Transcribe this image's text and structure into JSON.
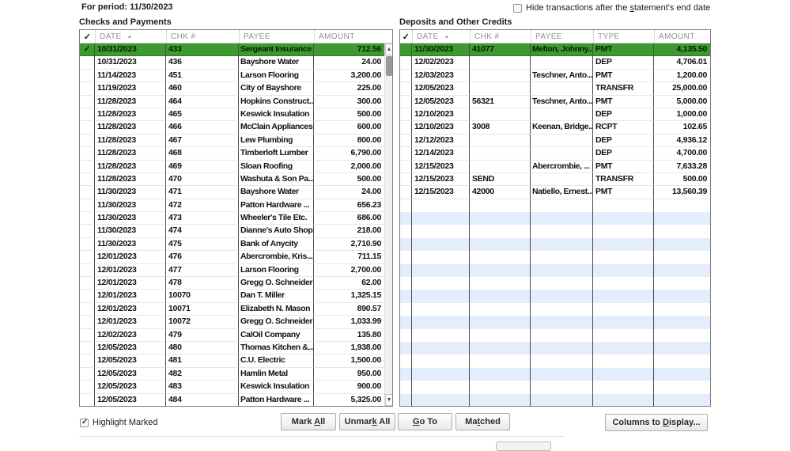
{
  "period_label": "For period: 11/30/2023",
  "hide_checkbox": {
    "checked": false,
    "label_pre": "Hide transactions after the ",
    "label_u": "s",
    "label_post": "tatement's end date"
  },
  "glyphs": {
    "check": "✓",
    "sort_arrow": "▲",
    "scroll_up": "▲",
    "scroll_down": "▼"
  },
  "checks": {
    "title": "Checks and Payments",
    "headers": [
      "DATE",
      "CHK #",
      "PAYEE",
      "AMOUNT"
    ],
    "rows": [
      {
        "checked": true,
        "highlight": true,
        "date": "10/31/2023",
        "chk": "433",
        "payee": "Sergeant Insurance",
        "amount": "712.56"
      },
      {
        "checked": false,
        "highlight": false,
        "date": "10/31/2023",
        "chk": "436",
        "payee": "Bayshore Water",
        "amount": "24.00"
      },
      {
        "checked": false,
        "highlight": false,
        "date": "11/14/2023",
        "chk": "451",
        "payee": "Larson Flooring",
        "amount": "3,200.00"
      },
      {
        "checked": false,
        "highlight": false,
        "date": "11/19/2023",
        "chk": "460",
        "payee": "City of Bayshore",
        "amount": "225.00"
      },
      {
        "checked": false,
        "highlight": false,
        "date": "11/28/2023",
        "chk": "464",
        "payee": "Hopkins Construct...",
        "amount": "300.00"
      },
      {
        "checked": false,
        "highlight": false,
        "date": "11/28/2023",
        "chk": "465",
        "payee": "Keswick Insulation",
        "amount": "500.00"
      },
      {
        "checked": false,
        "highlight": false,
        "date": "11/28/2023",
        "chk": "466",
        "payee": "McClain Appliances",
        "amount": "600.00"
      },
      {
        "checked": false,
        "highlight": false,
        "date": "11/28/2023",
        "chk": "467",
        "payee": "Lew Plumbing",
        "amount": "800.00"
      },
      {
        "checked": false,
        "highlight": false,
        "date": "11/28/2023",
        "chk": "468",
        "payee": "Timberloft Lumber",
        "amount": "6,790.00"
      },
      {
        "checked": false,
        "highlight": false,
        "date": "11/28/2023",
        "chk": "469",
        "payee": "Sloan Roofing",
        "amount": "2,000.00"
      },
      {
        "checked": false,
        "highlight": false,
        "date": "11/28/2023",
        "chk": "470",
        "payee": "Washuta & Son Pa...",
        "amount": "500.00"
      },
      {
        "checked": false,
        "highlight": false,
        "date": "11/30/2023",
        "chk": "471",
        "payee": "Bayshore Water",
        "amount": "24.00"
      },
      {
        "checked": false,
        "highlight": false,
        "date": "11/30/2023",
        "chk": "472",
        "payee": "Patton Hardware ...",
        "amount": "656.23"
      },
      {
        "checked": false,
        "highlight": false,
        "date": "11/30/2023",
        "chk": "473",
        "payee": "Wheeler's Tile Etc.",
        "amount": "686.00"
      },
      {
        "checked": false,
        "highlight": false,
        "date": "11/30/2023",
        "chk": "474",
        "payee": "Dianne's Auto Shop",
        "amount": "218.00"
      },
      {
        "checked": false,
        "highlight": false,
        "date": "11/30/2023",
        "chk": "475",
        "payee": "Bank of Anycity",
        "amount": "2,710.90"
      },
      {
        "checked": false,
        "highlight": false,
        "date": "12/01/2023",
        "chk": "476",
        "payee": "Abercrombie, Kris...",
        "amount": "711.15"
      },
      {
        "checked": false,
        "highlight": false,
        "date": "12/01/2023",
        "chk": "477",
        "payee": "Larson Flooring",
        "amount": "2,700.00"
      },
      {
        "checked": false,
        "highlight": false,
        "date": "12/01/2023",
        "chk": "478",
        "payee": "Gregg O. Schneider",
        "amount": "62.00"
      },
      {
        "checked": false,
        "highlight": false,
        "date": "12/01/2023",
        "chk": "10070",
        "payee": "Dan T. Miller",
        "amount": "1,325.15"
      },
      {
        "checked": false,
        "highlight": false,
        "date": "12/01/2023",
        "chk": "10071",
        "payee": "Elizabeth N. Mason",
        "amount": "890.57"
      },
      {
        "checked": false,
        "highlight": false,
        "date": "12/01/2023",
        "chk": "10072",
        "payee": "Gregg O. Schneider",
        "amount": "1,033.99"
      },
      {
        "checked": false,
        "highlight": false,
        "date": "12/02/2023",
        "chk": "479",
        "payee": "CalOil Company",
        "amount": "135.80"
      },
      {
        "checked": false,
        "highlight": false,
        "date": "12/05/2023",
        "chk": "480",
        "payee": "Thomas Kitchen &...",
        "amount": "1,938.00"
      },
      {
        "checked": false,
        "highlight": false,
        "date": "12/05/2023",
        "chk": "481",
        "payee": "C.U. Electric",
        "amount": "1,500.00"
      },
      {
        "checked": false,
        "highlight": false,
        "date": "12/05/2023",
        "chk": "482",
        "payee": "Hamlin Metal",
        "amount": "950.00"
      },
      {
        "checked": false,
        "highlight": false,
        "date": "12/05/2023",
        "chk": "483",
        "payee": "Keswick Insulation",
        "amount": "900.00"
      },
      {
        "checked": false,
        "highlight": false,
        "date": "12/05/2023",
        "chk": "484",
        "payee": "Patton Hardware ...",
        "amount": "5,325.00"
      }
    ]
  },
  "deposits": {
    "title": "Deposits and Other Credits",
    "headers": [
      "DATE",
      "CHK #",
      "PAYEE",
      "TYPE",
      "AMOUNT"
    ],
    "empty_row_count": 16,
    "rows": [
      {
        "checked": false,
        "highlight": true,
        "date": "11/30/2023",
        "chk": "41077",
        "payee": "Melton, Johnny...",
        "type": "PMT",
        "amount": "4,135.50"
      },
      {
        "checked": false,
        "highlight": false,
        "date": "12/02/2023",
        "chk": "",
        "payee": "",
        "type": "DEP",
        "amount": "4,706.01"
      },
      {
        "checked": false,
        "highlight": false,
        "date": "12/03/2023",
        "chk": "",
        "payee": "Teschner, Anto...",
        "type": "PMT",
        "amount": "1,200.00"
      },
      {
        "checked": false,
        "highlight": false,
        "date": "12/05/2023",
        "chk": "",
        "payee": "",
        "type": "TRANSFR",
        "amount": "25,000.00"
      },
      {
        "checked": false,
        "highlight": false,
        "date": "12/05/2023",
        "chk": "56321",
        "payee": "Teschner, Anto...",
        "type": "PMT",
        "amount": "5,000.00"
      },
      {
        "checked": false,
        "highlight": false,
        "date": "12/10/2023",
        "chk": "",
        "payee": "",
        "type": "DEP",
        "amount": "1,000.00"
      },
      {
        "checked": false,
        "highlight": false,
        "date": "12/10/2023",
        "chk": "3008",
        "payee": "Keenan, Bridge...",
        "type": "RCPT",
        "amount": "102.65"
      },
      {
        "checked": false,
        "highlight": false,
        "date": "12/12/2023",
        "chk": "",
        "payee": "",
        "type": "DEP",
        "amount": "4,936.12"
      },
      {
        "checked": false,
        "highlight": false,
        "date": "12/14/2023",
        "chk": "",
        "payee": "",
        "type": "DEP",
        "amount": "4,700.00"
      },
      {
        "checked": false,
        "highlight": false,
        "date": "12/15/2023",
        "chk": "",
        "payee": "Abercrombie, ...",
        "type": "PMT",
        "amount": "7,633.28"
      },
      {
        "checked": false,
        "highlight": false,
        "date": "12/15/2023",
        "chk": "SEND",
        "payee": "",
        "type": "TRANSFR",
        "amount": "500.00"
      },
      {
        "checked": false,
        "highlight": false,
        "date": "12/15/2023",
        "chk": "42000",
        "payee": "Natiello, Ernest...",
        "type": "PMT",
        "amount": "13,560.39"
      }
    ]
  },
  "footer": {
    "highlight_checkbox": {
      "checked": true,
      "label": "Highlight Marked"
    },
    "buttons": [
      {
        "pre": "Mark ",
        "u": "A",
        "post": "ll"
      },
      {
        "pre": "Unmar",
        "u": "k",
        "post": " All"
      },
      {
        "pre": "",
        "u": "G",
        "post": "o To"
      },
      {
        "pre": "Ma",
        "u": "t",
        "post": "ched"
      }
    ],
    "columns_button": {
      "pre": "Columns to ",
      "u": "D",
      "post": "isplay..."
    }
  },
  "colors": {
    "highlight_green": "#3d9a2f",
    "stripe_blue": "#e3edfb"
  }
}
